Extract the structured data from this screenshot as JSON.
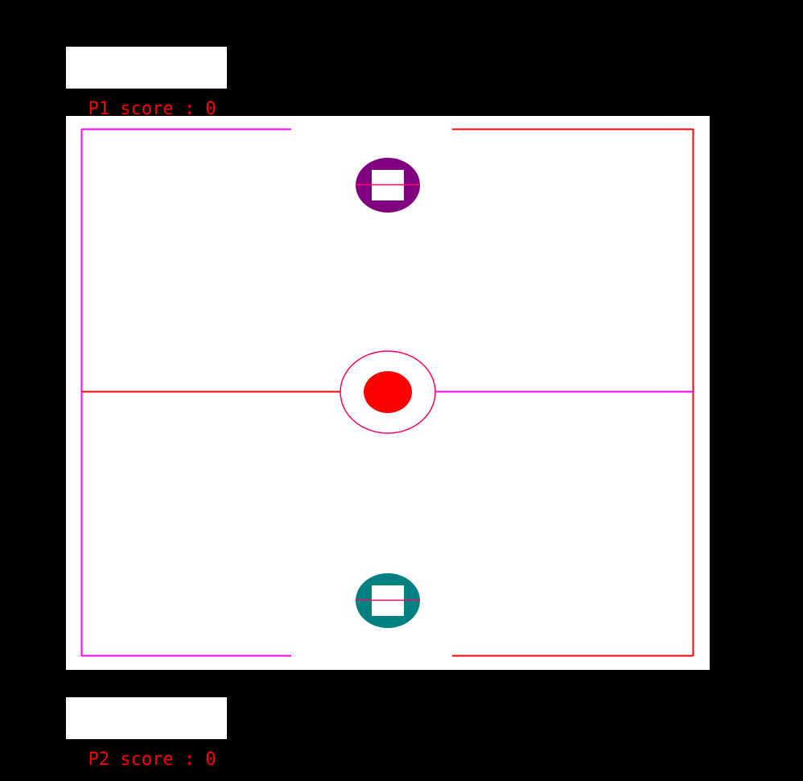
{
  "scoreboard": {
    "p1": "P1 score : 0",
    "p2": "P2 score : 0"
  },
  "colors": {
    "background": "#000000",
    "table": "#ffffff",
    "line_red": "#ff0000",
    "line_magenta": "#ff00ff",
    "puck": "#ff0000",
    "p1_mallet": "#800080",
    "p2_mallet": "#008080"
  },
  "game": {
    "players": [
      "P1",
      "P2"
    ],
    "p1_score": 0,
    "p2_score": 0
  }
}
